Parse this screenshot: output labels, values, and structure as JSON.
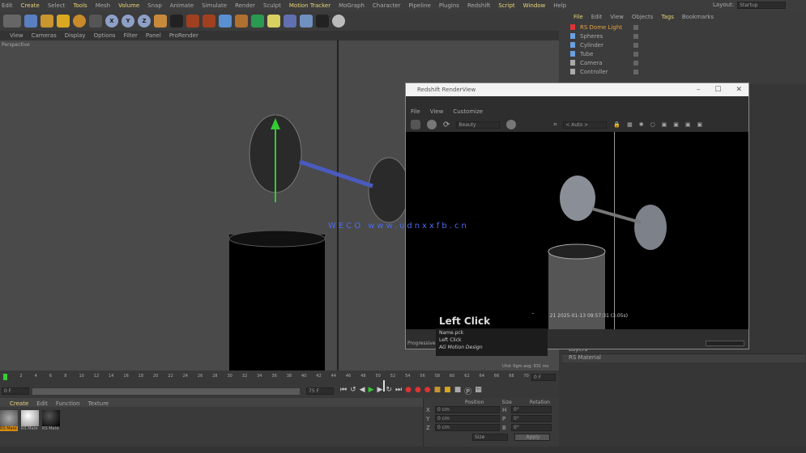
{
  "menubar": [
    "Edit",
    "Create",
    "Select",
    "Tools",
    "Mesh",
    "Volume",
    "Snap",
    "Animate",
    "Simulate",
    "Render",
    "Sculpt",
    "Motion Tracker",
    "MoGraph",
    "Character",
    "Pipeline",
    "Plugins",
    "Redshift",
    "Script",
    "Window",
    "Help"
  ],
  "layout": {
    "label": "Layout:",
    "value": "Startup"
  },
  "viewport": {
    "menu": [
      "View",
      "Cameras",
      "Display",
      "Options",
      "Filter",
      "Panel",
      "ProRender"
    ],
    "label": "Perspective"
  },
  "objects": {
    "menu": [
      "File",
      "Edit",
      "View",
      "Objects",
      "Tags",
      "Bookmarks"
    ],
    "items": [
      "RS Dome Light",
      "Spheres",
      "Cylinder",
      "Tube",
      "Camera",
      "Controller"
    ]
  },
  "render_window": {
    "title": "Redshift RenderView",
    "menu": [
      "File",
      "View",
      "Customize"
    ],
    "mode_select": "Beauty",
    "aov_select": "< Auto >",
    "frame_info": "Frame: 21  2025-01-13  09:57:31  (3.05s)",
    "progress_label": "Progressive",
    "stats": "Uhd: 0gm avg: 931 ms"
  },
  "tooltip": {
    "title": "Left Click",
    "lines": [
      "Name.pck",
      "Left Click",
      "AG Motion Design"
    ]
  },
  "watermark": "WECO www.udnxxfb.cn",
  "timeline": {
    "ticks": [
      "0",
      "2",
      "4",
      "6",
      "8",
      "10",
      "12",
      "14",
      "16",
      "18",
      "20",
      "22",
      "24",
      "26",
      "28",
      "30",
      "32",
      "34",
      "36",
      "38",
      "40",
      "42",
      "44",
      "46",
      "48",
      "50",
      "52",
      "54",
      "56",
      "58",
      "60",
      "62",
      "64",
      "66",
      "68",
      "70"
    ],
    "end_label": "0 F",
    "start_field": "0 F",
    "end_field": "75 F",
    "playhead_frame": "51"
  },
  "materials": {
    "menu": [
      "Create",
      "Edit",
      "Function",
      "Texture"
    ],
    "items": [
      "RS Mate",
      "RS Mate",
      "RS Mate"
    ]
  },
  "coordinates": {
    "headers": [
      "Position",
      "Size",
      "Rotation"
    ],
    "rows": [
      [
        "X",
        "0 cm",
        "H",
        "0°"
      ],
      [
        "Y",
        "0 cm",
        "P",
        "0°"
      ],
      [
        "Z",
        "0 cm",
        "B",
        "0°"
      ]
    ],
    "mode": "Size",
    "apply": "Apply"
  },
  "attributes": {
    "rows": [
      "Layers",
      "RS Material"
    ]
  }
}
